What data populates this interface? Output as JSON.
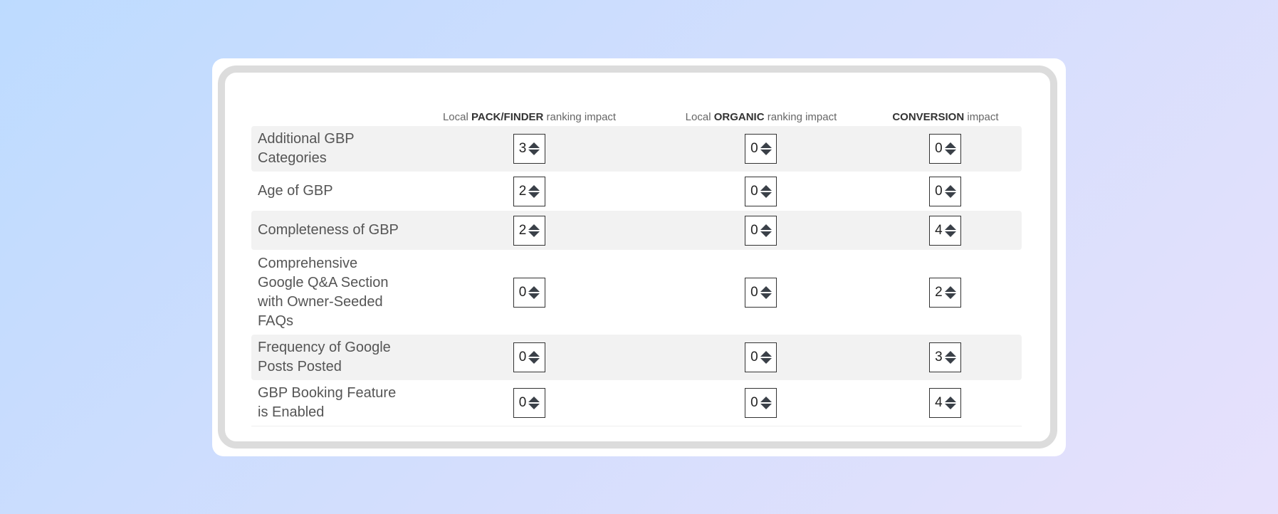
{
  "headers": [
    {
      "pre": "Local ",
      "bold": "PACK/FINDER",
      "post": " ranking impact"
    },
    {
      "pre": "Local ",
      "bold": "ORGANIC",
      "post": " ranking impact"
    },
    {
      "pre": "",
      "bold": "CONVERSION",
      "post": " impact"
    }
  ],
  "rows": [
    {
      "label": "Additional GBP Categories",
      "values": [
        "3",
        "0",
        "0"
      ]
    },
    {
      "label": "Age of GBP",
      "values": [
        "2",
        "0",
        "0"
      ]
    },
    {
      "label": "Completeness of GBP",
      "values": [
        "2",
        "0",
        "4"
      ]
    },
    {
      "label": "Comprehensive Google Q&A Section with Owner-Seeded FAQs",
      "values": [
        "0",
        "0",
        "2"
      ]
    },
    {
      "label": "Frequency of Google Posts Posted",
      "values": [
        "0",
        "0",
        "3"
      ]
    },
    {
      "label": "GBP Booking Feature is Enabled",
      "values": [
        "0",
        "0",
        "4"
      ]
    }
  ]
}
